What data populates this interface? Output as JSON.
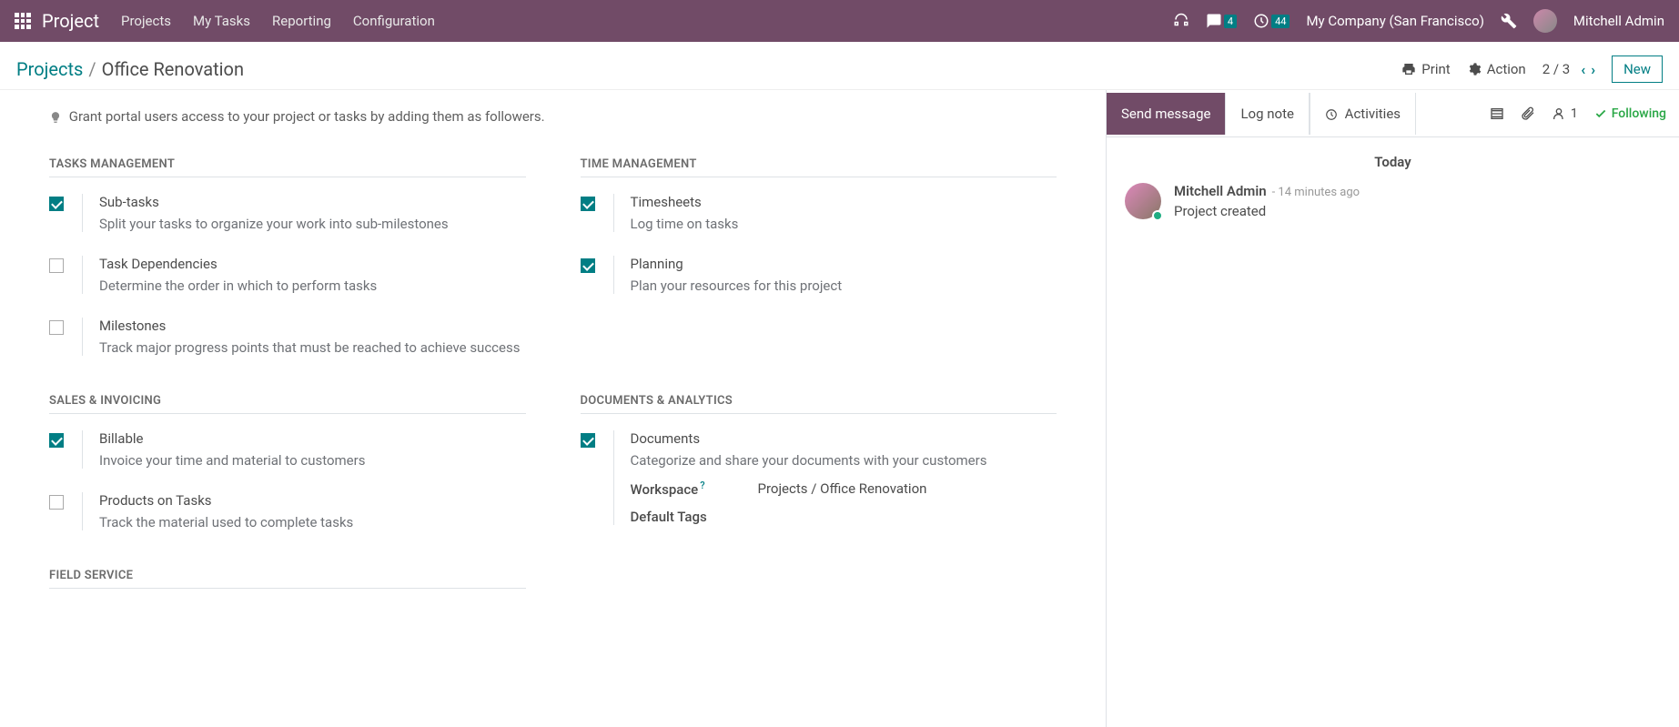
{
  "nav": {
    "app_title": "Project",
    "menu": [
      "Projects",
      "My Tasks",
      "Reporting",
      "Configuration"
    ],
    "messages_count": "4",
    "activities_count": "44",
    "company": "My Company (San Francisco)",
    "username": "Mitchell Admin"
  },
  "breadcrumb": {
    "parent": "Projects",
    "sep": "/",
    "current": "Office Renovation"
  },
  "cp": {
    "print": "Print",
    "action": "Action",
    "pager": "2 / 3",
    "new": "New"
  },
  "hint": "Grant portal users access to your project or tasks by adding them as followers.",
  "sections": {
    "tasks_mgmt": {
      "title": "TASKS MANAGEMENT",
      "subtasks": {
        "label": "Sub-tasks",
        "desc": "Split your tasks to organize your work into sub-milestones"
      },
      "deps": {
        "label": "Task Dependencies",
        "desc": "Determine the order in which to perform tasks"
      },
      "milestones": {
        "label": "Milestones",
        "desc": "Track major progress points that must be reached to achieve success"
      }
    },
    "time_mgmt": {
      "title": "TIME MANAGEMENT",
      "timesheets": {
        "label": "Timesheets",
        "desc": "Log time on tasks"
      },
      "planning": {
        "label": "Planning",
        "desc": "Plan your resources for this project"
      }
    },
    "sales": {
      "title": "SALES & INVOICING",
      "billable": {
        "label": "Billable",
        "desc": "Invoice your time and material to customers"
      },
      "products": {
        "label": "Products on Tasks",
        "desc": "Track the material used to complete tasks"
      }
    },
    "docs": {
      "title": "DOCUMENTS & ANALYTICS",
      "documents": {
        "label": "Documents",
        "desc": "Categorize and share your documents with your customers"
      },
      "workspace_lbl": "Workspace",
      "workspace_val": "Projects / Office Renovation",
      "tags_lbl": "Default Tags"
    },
    "field_service": {
      "title": "FIELD SERVICE"
    }
  },
  "chat": {
    "send": "Send message",
    "log": "Log note",
    "activities": "Activities",
    "followers": "1",
    "following": "Following",
    "day": "Today",
    "msg": {
      "author": "Mitchell Admin",
      "time": "- 14 minutes ago",
      "body": "Project created"
    }
  }
}
